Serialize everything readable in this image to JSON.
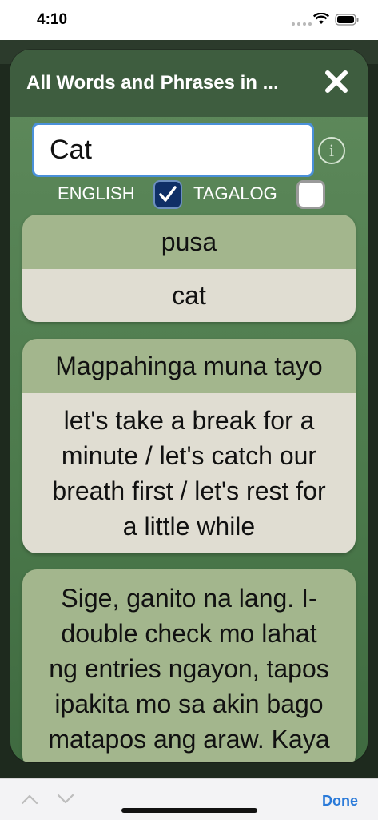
{
  "status": {
    "time": "4:10"
  },
  "modal": {
    "title": "All Words and Phrases in ..."
  },
  "search": {
    "value": "Cat",
    "placeholder": ""
  },
  "languages": {
    "english_label": "ENGLISH",
    "english_checked": true,
    "tagalog_label": "TAGALOG",
    "tagalog_checked": false
  },
  "results": [
    {
      "tagalog": "pusa",
      "english": "cat"
    },
    {
      "tagalog": "Magpahinga muna tayo",
      "english_lines": [
        "let's take a break for a",
        "minute / let's catch our",
        "breath first / let's rest for",
        "a little while"
      ]
    },
    {
      "tagalog_lines": [
        "Sige, ganito na lang. I-",
        "double check mo lahat",
        "ng entries ngayon, tapos",
        "ipakita mo sa akin bago",
        "matapos ang araw. Kaya"
      ]
    }
  ],
  "keyboard_bar": {
    "done_label": "Done"
  },
  "icons": {
    "close": "close-icon",
    "info": "info-icon",
    "check": "checkmark-icon",
    "prev": "chevron-up-icon",
    "next": "chevron-down-icon"
  },
  "colors": {
    "header": "#3e5d3f",
    "card_top": "#a3b68d",
    "card_bottom": "#e0ddd2",
    "accent": "#2a7ad9",
    "checkbox_checked": "#0f2f66"
  }
}
